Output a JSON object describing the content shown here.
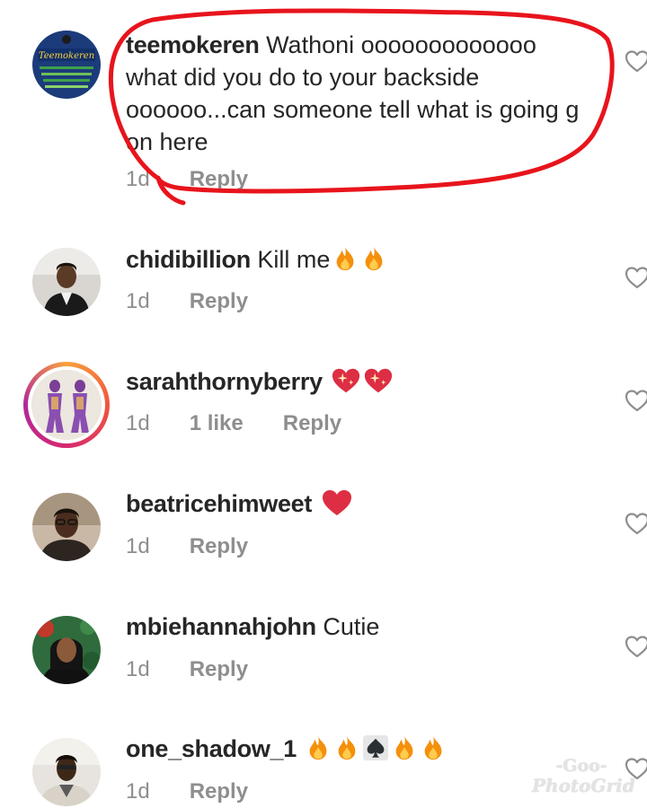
{
  "comments": [
    {
      "username": "teemokeren",
      "text": " Wathoni ooooooooooooo what did you do to your backside oooooo...can someone tell what is going g on here",
      "time": "1d",
      "reply": "Reply",
      "avatar_logo": "Teemokeren"
    },
    {
      "username": "chidibillion",
      "text": " Kill me",
      "emojis": [
        "fire-icon",
        "fire-icon"
      ],
      "time": "1d",
      "reply": "Reply"
    },
    {
      "username": "sarahthornyberry",
      "emojis": [
        "sparkling-heart-icon",
        "sparkling-heart-icon"
      ],
      "time": "1d",
      "likes": "1 like",
      "reply": "Reply"
    },
    {
      "username": "beatricehimweet",
      "emojis": [
        "red-heart-icon"
      ],
      "time": "1d",
      "reply": "Reply"
    },
    {
      "username": "mbiehannahjohn",
      "text": " Cutie",
      "time": "1d",
      "reply": "Reply"
    },
    {
      "username": "one_shadow_1",
      "emojis": [
        "fire-icon",
        "fire-icon",
        "spade-icon",
        "fire-icon",
        "fire-icon"
      ],
      "time": "1d",
      "reply": "Reply"
    }
  ],
  "watermark": {
    "line1": "-Goo-",
    "line2": "PhotoGrid"
  },
  "colors": {
    "text": "#262626",
    "meta": "#8e8e8e",
    "annotation": "#e8141c",
    "heart_outline": "#8e8e8e"
  },
  "icons": {
    "like_button": "heart-outline-icon"
  }
}
